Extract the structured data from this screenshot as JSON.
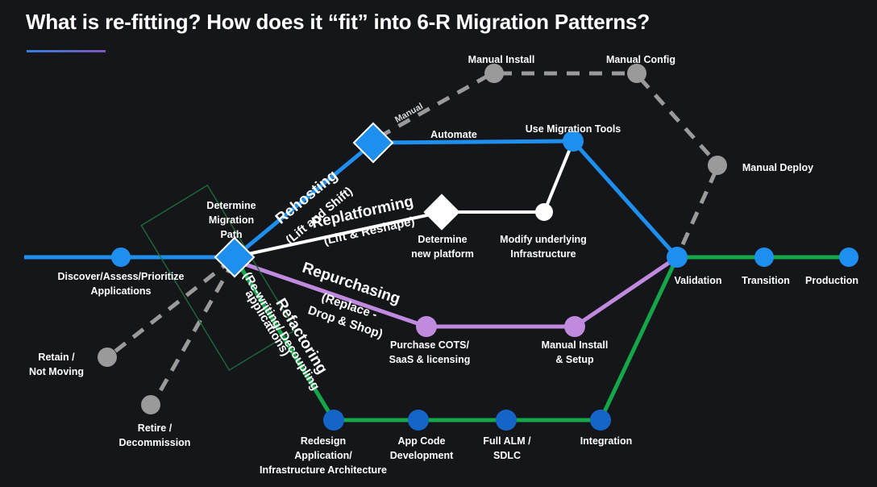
{
  "header": {
    "title": "What is re-fitting? How does it “fit” into 6-R Migration Patterns?"
  },
  "colors": {
    "background": "#141619",
    "blue": "#1f8fef",
    "green": "#15a64a",
    "purple": "#c08ade",
    "white": "#ffffff",
    "gray": "#9a9a9a",
    "box_green": "#1f6b3a",
    "rule_start": "#2f7fe0",
    "rule_end": "#7d56b8"
  },
  "nodes": {
    "discover": "Discover/Assess/Prioritize\nApplications",
    "discover_l1": "Discover/Assess/Prioritize",
    "discover_l2": "Applications",
    "determine_path_l1": "Determine",
    "determine_path_l2": "Migration",
    "determine_path_l3": "Path",
    "retain_l1": "Retain /",
    "retain_l2": "Not Moving",
    "retire_l1": "Retire /",
    "retire_l2": "Decommission",
    "manual_install_top": "Manual Install",
    "manual_config": "Manual Config",
    "manual_deploy": "Manual Deploy",
    "use_migration_tools": "Use Migration Tools",
    "determine_platform_l1": "Determine",
    "determine_platform_l2": "new platform",
    "modify_infra_l1": "Modify underlying",
    "modify_infra_l2": "Infrastructure",
    "purchase_cots_l1": "Purchase COTS/",
    "purchase_cots_l2": "SaaS & licensing",
    "manual_install_setup_l1": "Manual Install",
    "manual_install_setup_l2": "& Setup",
    "redesign_l1": "Redesign",
    "redesign_l2": "Application/",
    "redesign_l3": "Infrastructure Architecture",
    "app_code_l1": "App Code",
    "app_code_l2": "Development",
    "full_alm_l1": "Full ALM /",
    "full_alm_l2": "SDLC",
    "integration": "Integration",
    "validation": "Validation",
    "transition": "Transition",
    "production": "Production"
  },
  "edges": {
    "manual": "Manual",
    "automate": "Automate",
    "rehosting": "Rehosting",
    "rehosting_sub": "(Lift and Shift)",
    "replatforming": "Replatforming",
    "replatforming_sub": "(Lift & Reshape)",
    "repurchasing": "Repurchasing",
    "repurchasing_sub1": "(Replace -",
    "repurchasing_sub2": "Drop & Shop)",
    "refactoring": "Refactoring",
    "refactoring_sub1": "(Re-writing/ Decoupling",
    "refactoring_sub2": "applications)"
  }
}
